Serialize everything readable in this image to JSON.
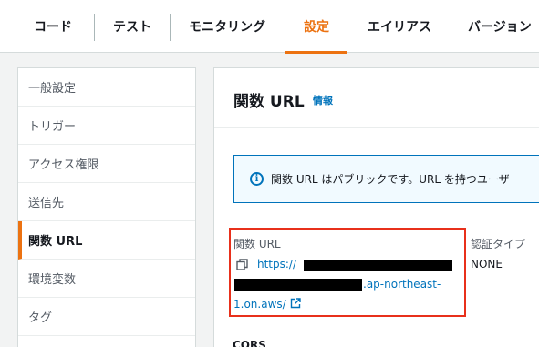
{
  "tabs": [
    {
      "label": "コード",
      "active": false
    },
    {
      "label": "テスト",
      "active": false
    },
    {
      "label": "モニタリング",
      "active": false
    },
    {
      "label": "設定",
      "active": true
    },
    {
      "label": "エイリアス",
      "active": false
    },
    {
      "label": "バージョン",
      "active": false
    }
  ],
  "sidebar": {
    "items": [
      {
        "label": "一般設定",
        "active": false
      },
      {
        "label": "トリガー",
        "active": false
      },
      {
        "label": "アクセス権限",
        "active": false
      },
      {
        "label": "送信先",
        "active": false
      },
      {
        "label": "関数 URL",
        "active": true
      },
      {
        "label": "環境変数",
        "active": false
      },
      {
        "label": "タグ",
        "active": false
      }
    ]
  },
  "main": {
    "title": "関数 URL",
    "info_link": "情報",
    "alert_text": "関数 URL はパブリックです。URL を持つユーザ",
    "function_url_label": "関数 URL",
    "url_part1": "https://",
    "url_part2": ".ap-northeast-",
    "url_part3": "1.on.aws/",
    "auth_type_label": "認証タイプ",
    "auth_type_value": "NONE",
    "cors_label": "CORS"
  },
  "colors": {
    "accent": "#ec7211",
    "link": "#0073bb",
    "highlight_box": "#e8301b",
    "info_bg": "#f1faff"
  }
}
